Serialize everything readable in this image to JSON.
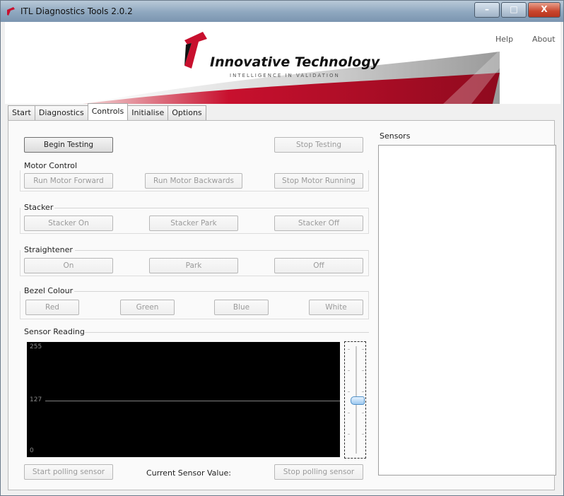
{
  "window": {
    "title": "ITL Diagnostics Tools 2.0.2",
    "controls": [
      "–",
      "□",
      "X"
    ]
  },
  "header": {
    "brand": "Innovative Technology",
    "tagline": "INTELLIGENCE IN VALIDATION",
    "menu": {
      "help": "Help",
      "about": "About"
    }
  },
  "tabs": [
    {
      "label": "Start",
      "active": false
    },
    {
      "label": "Diagnostics",
      "active": false
    },
    {
      "label": "Controls",
      "active": true
    },
    {
      "label": "Initialise",
      "active": false
    },
    {
      "label": "Options",
      "active": false
    }
  ],
  "controls": {
    "begin_testing": "Begin Testing",
    "stop_testing": "Stop Testing",
    "motor": {
      "label": "Motor Control",
      "forward": "Run Motor Forward",
      "backward": "Run Motor Backwards",
      "stop": "Stop Motor Running"
    },
    "stacker": {
      "label": "Stacker",
      "on": "Stacker On",
      "park": "Stacker Park",
      "off": "Stacker Off"
    },
    "straightener": {
      "label": "Straightener",
      "on": "On",
      "park": "Park",
      "off": "Off"
    },
    "bezel": {
      "label": "Bezel Colour",
      "red": "Red",
      "green": "Green",
      "blue": "Blue",
      "white": "White"
    },
    "sensor_reading": {
      "label": "Sensor Reading",
      "max": "255",
      "mid": "127",
      "min": "0",
      "slider_value": 127
    },
    "start_polling": "Start polling sensor",
    "current_value_label": "Current Sensor Value:",
    "stop_polling": "Stop polling sensor"
  },
  "sensors": {
    "label": "Sensors"
  },
  "colors": {
    "brand_red": "#c8102e",
    "background": "#f0f0f0"
  }
}
